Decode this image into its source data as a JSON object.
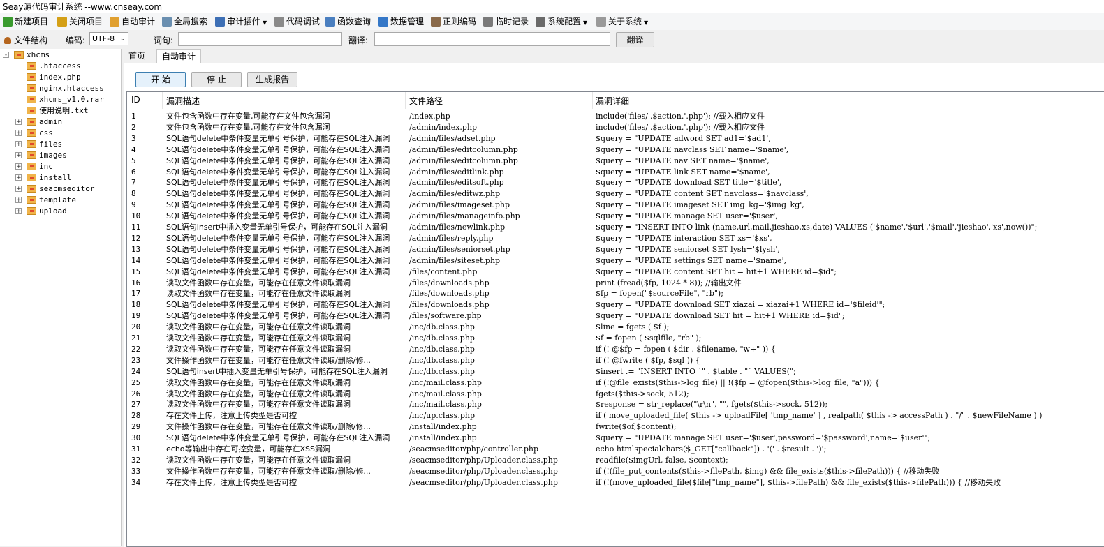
{
  "window": {
    "title": "Seay源代码审计系统  --www.cnseay.com"
  },
  "menu": [
    {
      "label": "新建项目",
      "icon": "new-project-icon",
      "color": "#3a9b2f",
      "dropdown": false
    },
    {
      "label": "关闭项目",
      "icon": "close-project-icon",
      "color": "#d4a017",
      "dropdown": false
    },
    {
      "label": "自动审计",
      "icon": "auto-audit-icon",
      "color": "#e0a030",
      "dropdown": false
    },
    {
      "label": "全局搜索",
      "icon": "global-search-icon",
      "color": "#6a8fb0",
      "dropdown": false
    },
    {
      "label": "审计插件",
      "icon": "audit-plugin-icon",
      "color": "#3d6fb5",
      "dropdown": true
    },
    {
      "label": "代码调试",
      "icon": "code-debug-icon",
      "color": "#8a8a8a",
      "dropdown": false
    },
    {
      "label": "函数查询",
      "icon": "function-query-icon",
      "color": "#4a7fc0",
      "dropdown": false
    },
    {
      "label": "数据管理",
      "icon": "data-manage-icon",
      "color": "#3578c8",
      "dropdown": false
    },
    {
      "label": "正则编码",
      "icon": "regex-encode-icon",
      "color": "#8a6a4a",
      "dropdown": false
    },
    {
      "label": "临时记录",
      "icon": "temp-record-icon",
      "color": "#7a7a7a",
      "dropdown": false
    },
    {
      "label": "系统配置",
      "icon": "gear-icon",
      "color": "#6a6a6a",
      "dropdown": true
    },
    {
      "label": "关于系统",
      "icon": "about-icon",
      "color": "#9a9a9a",
      "dropdown": true
    }
  ],
  "toolbar": {
    "file_structure_label": "文件结构",
    "encoding_label": "编码:",
    "encoding_value": "UTF-8",
    "word_label": "词句:",
    "word_value": "",
    "translate_label": "翻译:",
    "translate_value": "",
    "translate_button": "翻译"
  },
  "tree": {
    "root": "xhcms",
    "files": [
      ".htaccess",
      "index.php",
      "nginx.htaccess",
      "xhcms_v1.0.rar",
      "使用说明.txt"
    ],
    "folders": [
      "admin",
      "css",
      "files",
      "images",
      "inc",
      "install",
      "seacmseditor",
      "template",
      "upload"
    ]
  },
  "tabs": [
    {
      "label": "首页",
      "active": false
    },
    {
      "label": "自动审计",
      "active": true
    }
  ],
  "actions": {
    "start": "开 始",
    "stop": "停 止",
    "report": "生成报告"
  },
  "table": {
    "columns": [
      "ID",
      "漏洞描述",
      "文件路径",
      "漏洞详细"
    ],
    "rows": [
      [
        "1",
        "文件包含函数中存在变量,可能存在文件包含漏洞",
        "/index.php",
        "include('files/'.$action.'.php'); //载入相应文件"
      ],
      [
        "2",
        "文件包含函数中存在变量,可能存在文件包含漏洞",
        "/admin/index.php",
        "include('files/'.$action.'.php'); //载入相应文件"
      ],
      [
        "3",
        "SQL语句delete中条件变量无单引号保护，可能存在SQL注入漏洞",
        "/admin/files/adset.php",
        "$query = \"UPDATE adword SET ad1='$ad1',"
      ],
      [
        "4",
        "SQL语句delete中条件变量无单引号保护，可能存在SQL注入漏洞",
        "/admin/files/editcolumn.php",
        "$query = \"UPDATE navclass SET name='$name',"
      ],
      [
        "5",
        "SQL语句delete中条件变量无单引号保护，可能存在SQL注入漏洞",
        "/admin/files/editcolumn.php",
        "$query = \"UPDATE nav SET name='$name',"
      ],
      [
        "6",
        "SQL语句delete中条件变量无单引号保护，可能存在SQL注入漏洞",
        "/admin/files/editlink.php",
        "$query = \"UPDATE link SET name='$name',"
      ],
      [
        "7",
        "SQL语句delete中条件变量无单引号保护，可能存在SQL注入漏洞",
        "/admin/files/editsoft.php",
        "$query = \"UPDATE download SET title='$title',"
      ],
      [
        "8",
        "SQL语句delete中条件变量无单引号保护，可能存在SQL注入漏洞",
        "/admin/files/editwz.php",
        "$query = \"UPDATE content SET navclass='$navclass',"
      ],
      [
        "9",
        "SQL语句delete中条件变量无单引号保护，可能存在SQL注入漏洞",
        "/admin/files/imageset.php",
        "$query = \"UPDATE imageset SET img_kg='$img_kg',"
      ],
      [
        "10",
        "SQL语句delete中条件变量无单引号保护，可能存在SQL注入漏洞",
        "/admin/files/manageinfo.php",
        "$query = \"UPDATE manage SET user='$user',"
      ],
      [
        "11",
        "SQL语句insert中插入变量无单引号保护，可能存在SQL注入漏洞",
        "/admin/files/newlink.php",
        "$query = \"INSERT INTO link (name,url,mail,jieshao,xs,date) VALUES ('$name','$url','$mail','jieshao','xs',now())\";"
      ],
      [
        "12",
        "SQL语句delete中条件变量无单引号保护，可能存在SQL注入漏洞",
        "/admin/files/reply.php",
        "$query = \"UPDATE interaction SET xs='$xs',"
      ],
      [
        "13",
        "SQL语句delete中条件变量无单引号保护，可能存在SQL注入漏洞",
        "/admin/files/seniorset.php",
        "$query = \"UPDATE seniorset SET lysh='$lysh',"
      ],
      [
        "14",
        "SQL语句delete中条件变量无单引号保护，可能存在SQL注入漏洞",
        "/admin/files/siteset.php",
        "$query = \"UPDATE settings SET name='$name',"
      ],
      [
        "15",
        "SQL语句delete中条件变量无单引号保护，可能存在SQL注入漏洞",
        "/files/content.php",
        "$query = \"UPDATE content SET hit = hit+1 WHERE id=$id\";"
      ],
      [
        "16",
        "读取文件函数中存在变量，可能存在任意文件读取漏洞",
        "/files/downloads.php",
        "print (fread($fp, 1024 * 8)); //输出文件"
      ],
      [
        "17",
        "读取文件函数中存在变量，可能存在任意文件读取漏洞",
        "/files/downloads.php",
        "$fp = fopen(\"$sourceFile\", \"rb\");"
      ],
      [
        "18",
        "SQL语句delete中条件变量无单引号保护，可能存在SQL注入漏洞",
        "/files/downloads.php",
        "$query = \"UPDATE download SET xiazai = xiazai+1 WHERE id='$fileid'\";"
      ],
      [
        "19",
        "SQL语句delete中条件变量无单引号保护，可能存在SQL注入漏洞",
        "/files/software.php",
        "$query = \"UPDATE download SET hit = hit+1 WHERE id=$id\";"
      ],
      [
        "20",
        "读取文件函数中存在变量，可能存在任意文件读取漏洞",
        "/inc/db.class.php",
        "$line = fgets ( $f );"
      ],
      [
        "21",
        "读取文件函数中存在变量，可能存在任意文件读取漏洞",
        "/inc/db.class.php",
        "$f = fopen ( $sqlfile, \"rb\" );"
      ],
      [
        "22",
        "读取文件函数中存在变量，可能存在任意文件读取漏洞",
        "/inc/db.class.php",
        "if (! @$fp = fopen ( $dir . $filename, \"w+\" )) {"
      ],
      [
        "23",
        "文件操作函数中存在变量，可能存在任意文件读取/删除/修...",
        "/inc/db.class.php",
        "if (! @fwrite ( $fp, $sql )) {"
      ],
      [
        "24",
        "SQL语句insert中插入变量无单引号保护，可能存在SQL注入漏洞",
        "/inc/db.class.php",
        "$insert .= \"INSERT INTO `\" . $table . \"` VALUES(\";"
      ],
      [
        "25",
        "读取文件函数中存在变量，可能存在任意文件读取漏洞",
        "/inc/mail.class.php",
        "if (!@file_exists($this->log_file) || !($fp = @fopen($this->log_file, \"a\"))) {"
      ],
      [
        "26",
        "读取文件函数中存在变量，可能存在任意文件读取漏洞",
        "/inc/mail.class.php",
        "fgets($this->sock, 512);"
      ],
      [
        "27",
        "读取文件函数中存在变量，可能存在任意文件读取漏洞",
        "/inc/mail.class.php",
        "$response = str_replace(\"\\r\\n\", \"\", fgets($this->sock, 512));"
      ],
      [
        "28",
        "存在文件上传，注意上传类型是否可控",
        "/inc/up.class.php",
        "if ( move_uploaded_file( $this -> uploadFile[ 'tmp_name' ] , realpath( $this -> accessPath ) . \"/\" . $newFileName ) )"
      ],
      [
        "29",
        "文件操作函数中存在变量，可能存在任意文件读取/删除/修...",
        "/install/index.php",
        "fwrite($of,$content);"
      ],
      [
        "30",
        "SQL语句delete中条件变量无单引号保护，可能存在SQL注入漏洞",
        "/install/index.php",
        "$query = \"UPDATE manage SET user='$user',password='$password',name='$user'\";"
      ],
      [
        "31",
        "echo等输出中存在可控变量，可能存在XSS漏洞",
        "/seacmseditor/php/controller.php",
        "echo htmlspecialchars($_GET[\"callback\"]) . '(' . $result . ')';"
      ],
      [
        "32",
        "读取文件函数中存在变量，可能存在任意文件读取漏洞",
        "/seacmseditor/php/Uploader.class.php",
        "readfile($imgUrl, false, $context);"
      ],
      [
        "33",
        "文件操作函数中存在变量，可能存在任意文件读取/删除/修...",
        "/seacmseditor/php/Uploader.class.php",
        "if (!(file_put_contents($this->filePath, $img) && file_exists($this->filePath))) { //移动失败"
      ],
      [
        "34",
        "存在文件上传，注意上传类型是否可控",
        "/seacmseditor/php/Uploader.class.php",
        "if (!(move_uploaded_file($file[\"tmp_name\"], $this->filePath) && file_exists($this->filePath))) { //移动失败"
      ]
    ]
  }
}
